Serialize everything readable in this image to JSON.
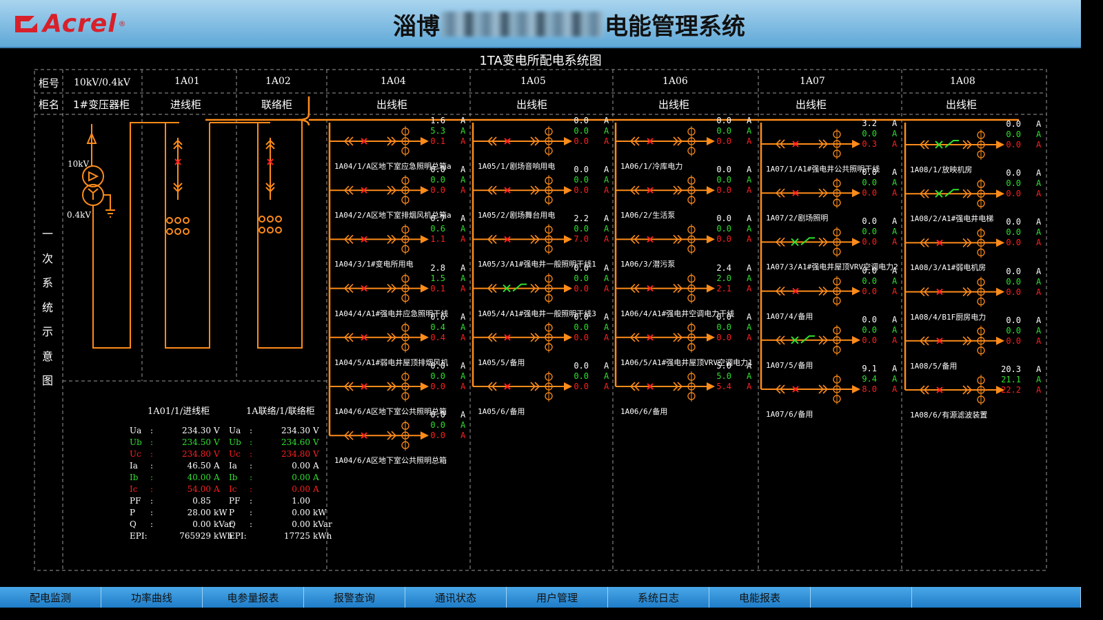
{
  "header": {
    "brand": "Acrel",
    "registered": "®",
    "title_prefix": "淄博",
    "title_suffix": "电能管理系统"
  },
  "diagram_title": "1TA变电所配电系统图",
  "row_labels": {
    "code": "柜号",
    "name": "柜名"
  },
  "side_label": [
    "一",
    "次",
    "系",
    "统",
    "示",
    "意",
    "图"
  ],
  "transformer": {
    "code": "10kV/0.4kV",
    "name": "1#变压器柜",
    "hv": "10kV",
    "lv": "0.4kV"
  },
  "cabinets": [
    {
      "code": "1A01",
      "name": "进线柜"
    },
    {
      "code": "1A02",
      "name": "联络柜"
    },
    {
      "code": "1A04",
      "name": "出线柜"
    },
    {
      "code": "1A05",
      "name": "出线柜"
    },
    {
      "code": "1A06",
      "name": "出线柜"
    },
    {
      "code": "1A07",
      "name": "出线柜"
    },
    {
      "code": "1A08",
      "name": "出线柜"
    }
  ],
  "unit_A": "A",
  "feeders": [
    {
      "code": "1A04",
      "circuits": [
        {
          "name": "1A04/1/A区地下室应急照明总箱a",
          "ia": "1.6",
          "ib": "5.3",
          "ic": "0.1",
          "state": "off"
        },
        {
          "name": "1A04/2/A区地下室排烟风机总箱a",
          "ia": "0.0",
          "ib": "0.0",
          "ic": "0.0",
          "state": "off"
        },
        {
          "name": "1A04/3/1#变电所用电",
          "ia": "0.7",
          "ib": "0.6",
          "ic": "1.1",
          "state": "off"
        },
        {
          "name": "1A04/4/A1#强电井应急照明干线",
          "ia": "2.8",
          "ib": "1.5",
          "ic": "0.1",
          "state": "off"
        },
        {
          "name": "1A04/5/A1#弱电井屋顶排烟风机",
          "ia": "0.6",
          "ib": "0.4",
          "ic": "0.4",
          "state": "off"
        },
        {
          "name": "1A04/6/A区地下室公共照明总箱",
          "ia": "0.0",
          "ib": "0.0",
          "ic": "0.0",
          "state": "off"
        },
        {
          "name": "1A04/6/A区地下室公共照明总箱",
          "ia": "0.0",
          "ib": "0.0",
          "ic": "0.0",
          "state": "off"
        }
      ]
    },
    {
      "code": "1A05",
      "circuits": [
        {
          "name": "1A05/1/剧场音响用电",
          "ia": "0.0",
          "ib": "0.0",
          "ic": "0.0",
          "state": "off"
        },
        {
          "name": "1A05/2/剧场舞台用电",
          "ia": "0.0",
          "ib": "0.0",
          "ic": "0.0",
          "state": "off"
        },
        {
          "name": "1A05/3/A1#强电井一般照明干线1",
          "ia": "2.2",
          "ib": "0.0",
          "ic": "7.0",
          "state": "off"
        },
        {
          "name": "1A05/4/A1#强电井一般照明干线3",
          "ia": "0.0",
          "ib": "0.0",
          "ic": "0.0",
          "state": "on"
        },
        {
          "name": "1A05/5/备用",
          "ia": "0.0",
          "ib": "0.0",
          "ic": "0.0",
          "state": "off"
        },
        {
          "name": "1A05/6/备用",
          "ia": "0.0",
          "ib": "0.0",
          "ic": "0.0",
          "state": "off"
        }
      ]
    },
    {
      "code": "1A06",
      "circuits": [
        {
          "name": "1A06/1/冷库电力",
          "ia": "0.0",
          "ib": "0.0",
          "ic": "0.0",
          "state": "off"
        },
        {
          "name": "1A06/2/生活泵",
          "ia": "0.0",
          "ib": "0.0",
          "ic": "0.0",
          "state": "off"
        },
        {
          "name": "1A06/3/潜污泵",
          "ia": "0.0",
          "ib": "0.0",
          "ic": "0.0",
          "state": "off"
        },
        {
          "name": "1A06/4/A1#强电井空调电力干线",
          "ia": "2.4",
          "ib": "2.0",
          "ic": "2.1",
          "state": "off"
        },
        {
          "name": "1A06/5/A1#强电井屋顶VRV空调电力1",
          "ia": "0.0",
          "ib": "0.0",
          "ic": "0.0",
          "state": "off"
        },
        {
          "name": "1A06/6/备用",
          "ia": "5.0",
          "ib": "5.0",
          "ic": "5.4",
          "state": "off"
        }
      ]
    },
    {
      "code": "1A07",
      "circuits": [
        {
          "name": "1A07/1/A1#强电井公共照明干线",
          "ia": "3.2",
          "ib": "0.0",
          "ic": "0.3",
          "state": "off"
        },
        {
          "name": "1A07/2/剧场照明",
          "ia": "0.0",
          "ib": "0.0",
          "ic": "0.0",
          "state": "off"
        },
        {
          "name": "1A07/3/A1#强电井屋顶VRV空调电力2",
          "ia": "0.0",
          "ib": "0.0",
          "ic": "0.0",
          "state": "on"
        },
        {
          "name": "1A07/4/备用",
          "ia": "0.0",
          "ib": "0.0",
          "ic": "0.0",
          "state": "off"
        },
        {
          "name": "1A07/5/备用",
          "ia": "0.0",
          "ib": "0.0",
          "ic": "0.0",
          "state": "on"
        },
        {
          "name": "1A07/6/备用",
          "ia": "9.1",
          "ib": "9.4",
          "ic": "8.0",
          "state": "off"
        }
      ]
    },
    {
      "code": "1A08",
      "circuits": [
        {
          "name": "1A08/1/放映机房",
          "ia": "0.0",
          "ib": "0.0",
          "ic": "0.0",
          "state": "on"
        },
        {
          "name": "1A08/2/A1#强电井电梯",
          "ia": "0.0",
          "ib": "0.0",
          "ic": "0.0",
          "state": "on"
        },
        {
          "name": "1A08/3/A1#弱电机房",
          "ia": "0.0",
          "ib": "0.0",
          "ic": "0.0",
          "state": "off"
        },
        {
          "name": "1A08/4/B1F厨房电力",
          "ia": "0.0",
          "ib": "0.0",
          "ic": "0.0",
          "state": "off"
        },
        {
          "name": "1A08/5/备用",
          "ia": "0.0",
          "ib": "0.0",
          "ic": "0.0",
          "state": "off"
        },
        {
          "name": "1A08/6/有源滤波装置",
          "ia": "20.3",
          "ib": "21.1",
          "ic": "22.2",
          "state": "off"
        }
      ]
    }
  ],
  "meters": [
    {
      "title": "1A01/1/进线柜",
      "rows": [
        {
          "k": "Ua",
          "v": "234.30",
          "u": "V",
          "c": "w"
        },
        {
          "k": "Ub",
          "v": "234.50",
          "u": "V",
          "c": "g"
        },
        {
          "k": "Uc",
          "v": "234.80",
          "u": "V",
          "c": "r"
        },
        {
          "k": "Ia",
          "v": "46.50",
          "u": "A",
          "c": "w"
        },
        {
          "k": "Ib",
          "v": "40.00",
          "u": "A",
          "c": "g"
        },
        {
          "k": "Ic",
          "v": "54.00",
          "u": "A",
          "c": "r"
        },
        {
          "k": "PF",
          "v": "0.85",
          "u": "",
          "c": "w"
        },
        {
          "k": "P",
          "v": "28.00",
          "u": "kW",
          "c": "w"
        },
        {
          "k": "Q",
          "v": "0.00",
          "u": "kVar",
          "c": "w"
        },
        {
          "k": "EPI:",
          "v": "765929",
          "u": "kWh",
          "c": "w",
          "nocolon": true
        }
      ]
    },
    {
      "title": "1A联络/1/联络柜",
      "rows": [
        {
          "k": "Ua",
          "v": "234.30",
          "u": "V",
          "c": "w"
        },
        {
          "k": "Ub",
          "v": "234.60",
          "u": "V",
          "c": "g"
        },
        {
          "k": "Uc",
          "v": "234.80",
          "u": "V",
          "c": "r"
        },
        {
          "k": "Ia",
          "v": "0.00",
          "u": "A",
          "c": "w"
        },
        {
          "k": "Ib",
          "v": "0.00",
          "u": "A",
          "c": "g"
        },
        {
          "k": "Ic",
          "v": "0.00",
          "u": "A",
          "c": "r"
        },
        {
          "k": "PF",
          "v": "1.00",
          "u": "",
          "c": "w"
        },
        {
          "k": "P",
          "v": "0.00",
          "u": "kW",
          "c": "w"
        },
        {
          "k": "Q",
          "v": "0.00",
          "u": "kVar",
          "c": "w"
        },
        {
          "k": "EPI:",
          "v": "17725",
          "u": "kWh",
          "c": "w",
          "nocolon": true
        }
      ]
    }
  ],
  "nav": [
    "配电监测",
    "功率曲线",
    "电参量报表",
    "报警查询",
    "通讯状态",
    "用户管理",
    "系统日志",
    "电能报表",
    "",
    ""
  ],
  "colors": {
    "bus": "#ff8c1a",
    "breaker_open": "#ff2020",
    "breaker_closed": "#2fe02f",
    "grid": "#9a9a9a",
    "header": "#7fbde3",
    "nav": "#2a8ad8"
  }
}
